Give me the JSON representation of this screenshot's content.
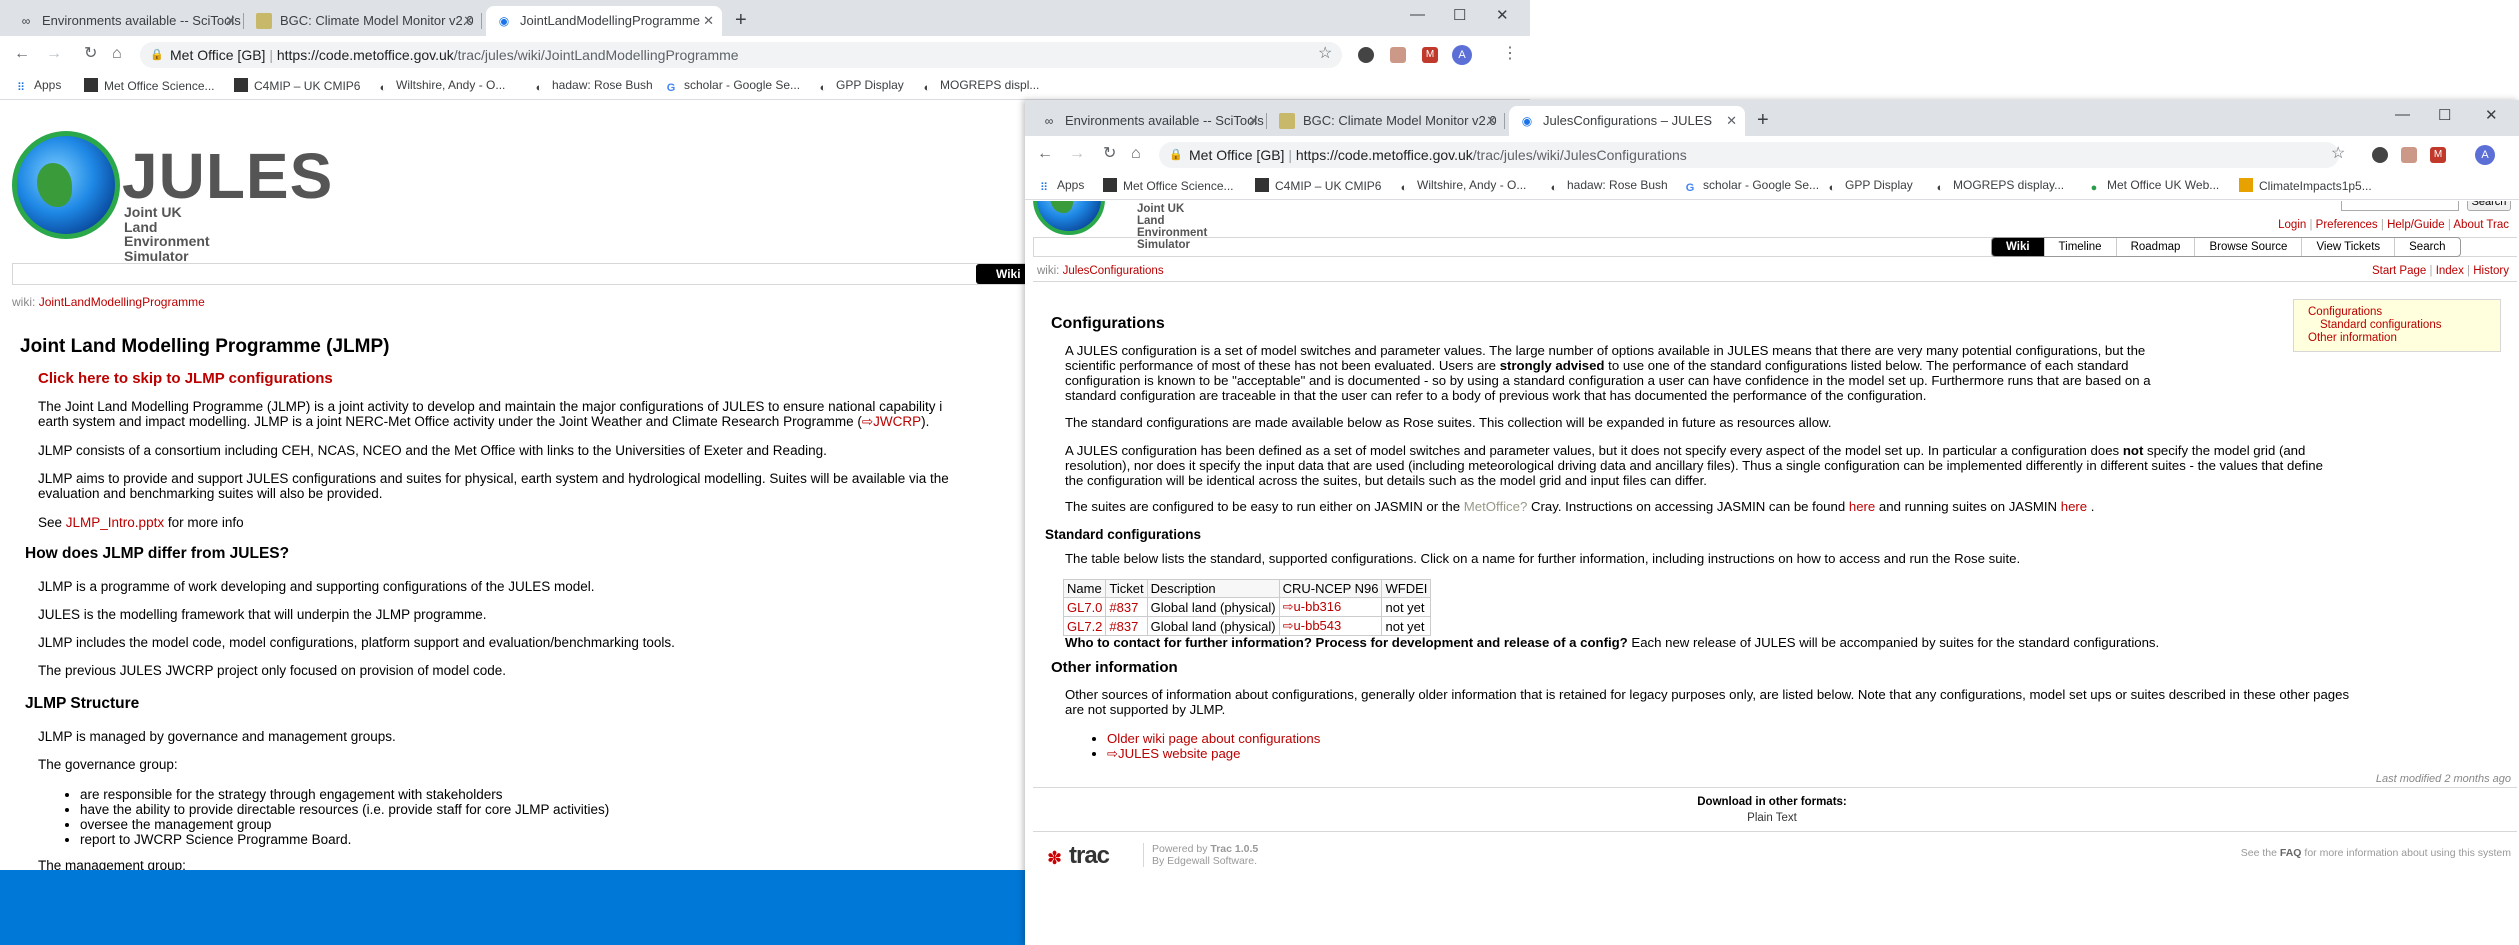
{
  "left_window": {
    "tabs": [
      {
        "title": "Environments available -- SciTools",
        "icon": "glasses-icon"
      },
      {
        "title": "BGC: Climate Model Monitor v2.0",
        "icon": "image-icon"
      },
      {
        "title": "JointLandModellingProgramme",
        "icon": "trac-icon"
      }
    ],
    "omnibox": {
      "org": "Met Office [GB]",
      "url_prefix": "https://code.metoffice.gov.uk",
      "url_path": "/trac/jules/wiki/JointLandModellingProgramme"
    },
    "bookmarks": [
      "Apps",
      "Met Office Science...",
      "C4MIP – UK CMIP6",
      "Wiltshire, Andy - O...",
      "hadaw: Rose Bush",
      "scholar - Google Se...",
      "GPP Display",
      "MOGREPS displ..."
    ],
    "logo": {
      "word": "JULES",
      "sub1": "Joint UK Land",
      "sub2": "Environment Simulator"
    },
    "nav_active": "Wiki",
    "breadcrumb": {
      "prefix": "wiki:",
      "page": "JointLandModellingProgramme"
    },
    "title": "Joint Land Modelling Programme (JLMP)",
    "skip_link": "Click here to skip to JLMP configurations",
    "p1a": "The Joint Land Modelling Programme (JLMP) is a joint activity to develop and maintain the major configurations of JULES to ensure national capability i",
    "p1b": "earth system and impact modelling. JLMP is a joint NERC-Met Office activity under the Joint Weather and Climate Research Programme (",
    "p1_link": "⇨JWCRP",
    "p1_end": ").",
    "p2": "JLMP consists of a consortium including CEH, NCAS, NCEO and the Met Office with links to the Universities of Exeter and Reading.",
    "p3a": "JLMP aims to provide and support JULES configurations and suites for physical, earth system and hydrological modelling. Suites will be available via the",
    "p3b": "evaluation and benchmarking suites will also be provided.",
    "p4_pre": "See ",
    "p4_link": "JLMP_Intro.pptx",
    "p4_post": " for more info",
    "h2a": "How does JLMP differ from JULES?",
    "p5": "JLMP is a programme of work developing and supporting configurations of the JULES model.",
    "p6": "JULES is the modelling framework that will underpin the JLMP programme.",
    "p7": "JLMP includes the model code, model configurations, platform support and evaluation/benchmarking tools.",
    "p8": "The previous JULES JWCRP project only focused on provision of model code.",
    "h2b": "JLMP Structure",
    "p9": "JLMP is managed by governance and management groups.",
    "p10": "The governance group:",
    "gov_list": [
      "are responsible for the strategy through engagement with stakeholders",
      "have the ability to provide directable resources (i.e. provide staff for core JLMP activities)",
      "oversee the management group",
      "report to JWCRP Science Programme Board."
    ],
    "p11": "The management group:"
  },
  "right_window": {
    "tabs": [
      {
        "title": "Environments available -- SciTools",
        "icon": "glasses-icon"
      },
      {
        "title": "BGC: Climate Model Monitor v2.0",
        "icon": "image-icon"
      },
      {
        "title": "JulesConfigurations – JULES",
        "icon": "trac-icon"
      }
    ],
    "omnibox": {
      "org": "Met Office [GB]",
      "url_prefix": "https://code.metoffice.gov.uk",
      "url_path": "/trac/jules/wiki/JulesConfigurations"
    },
    "bookmarks": [
      "Apps",
      "Met Office Science...",
      "C4MIP – UK CMIP6",
      "Wiltshire, Andy - O...",
      "hadaw: Rose Bush",
      "scholar - Google Se...",
      "GPP Display",
      "MOGREPS display...",
      "Met Office UK Web...",
      "ClimateImpacts1p5..."
    ],
    "logo": {
      "sub1": "Joint UK Land",
      "sub2": "Environment Simulator"
    },
    "search_button": "Search",
    "metanav": [
      "Login",
      "Preferences",
      "Help/Guide",
      "About Trac"
    ],
    "mainnav": [
      "Wiki",
      "Timeline",
      "Roadmap",
      "Browse Source",
      "View Tickets",
      "Search"
    ],
    "breadcrumb": {
      "prefix": "wiki:",
      "page": "JulesConfigurations"
    },
    "ctxnav": [
      "Start Page",
      "Index",
      "History"
    ],
    "toc": [
      "Configurations",
      "Standard configurations",
      "Other information"
    ],
    "title": "Configurations",
    "p1a": "A JULES configuration is a set of model switches and parameter values. The large number of options available in JULES means that there are very many potential configurations, but the",
    "p1b_pre": "scientific performance of most of these has not been evaluated. Users are ",
    "p1b_bold": "strongly advised",
    "p1b_post": " to use one of the standard configurations listed below. The performance of each standard",
    "p1c": "configuration is known to be \"acceptable\" and is documented - so by using a standard configuration a user can have confidence in the model set up. Furthermore runs that are based on a",
    "p1d": "standard configuration are traceable in that the user can refer to a body of previous work that has documented the performance of the configuration.",
    "p2": "The standard configurations are made available below as Rose suites. This collection will be expanded in future as resources allow.",
    "p3a_pre": "A JULES configuration has been defined as a set of model switches and parameter values, but it does not specify every aspect of the model set up. In particular a configuration does ",
    "p3a_bold": "not",
    "p3a_post": " specify the model grid (and",
    "p3b": "resolution), nor does it specify the input data that are used (including meteorological driving data and ancillary files). Thus a single configuration can be implemented differently in different suites - the values that define",
    "p3c": "the configuration will be identical across the suites, but details such as the model grid and input files can differ.",
    "p4_pre": "The suites are configured to be easy to run either on JASMIN or the ",
    "p4_missing": "MetOffice?",
    "p4_mid": " Cray. Instructions on accessing JASMIN can be found ",
    "p4_here1": "here",
    "p4_mid2": " and running suites on JASMIN ",
    "p4_here2": "here",
    "p4_end": " .",
    "h2a": "Standard configurations",
    "p5": "The table below lists the standard, supported configurations. Click on a name for further information, including instructions on how to access and run the Rose suite.",
    "table": {
      "headers": [
        "Name",
        "Ticket",
        "Description",
        "CRU-NCEP N96",
        "WFDEI"
      ],
      "rows": [
        [
          "GL7.0",
          "#837",
          "Global land (physical)",
          "⇨u-bb316",
          "not yet"
        ],
        [
          "GL7.2",
          "#837",
          "Global land (physical)",
          "⇨u-bb543",
          "not yet"
        ]
      ]
    },
    "p6_bold": "Who to contact for further information? Process for development and release of a config?",
    "p6_post": " Each new release of JULES will be accompanied by suites for the standard configurations.",
    "h2b": "Other information",
    "p7a": "Other sources of information about configurations, generally older information that is retained for legacy purposes only, are listed below. Note that any configurations, model set ups or suites described in these other pages",
    "p7b": "are not supported by JLMP.",
    "links": [
      "Older wiki page about configurations",
      "⇨JULES website page"
    ],
    "last_modified": "Last modified 2 months ago",
    "download_title": "Download in other formats:",
    "download_link": "Plain Text",
    "footer_powered": "Powered by ",
    "footer_trac": "Trac 1.0.5",
    "footer_by": "By Edgewall Software.",
    "footer_right_pre": "See the ",
    "footer_right_faq": "FAQ",
    "footer_right_post": " for more information about using this system",
    "trac_logo": "trac"
  }
}
